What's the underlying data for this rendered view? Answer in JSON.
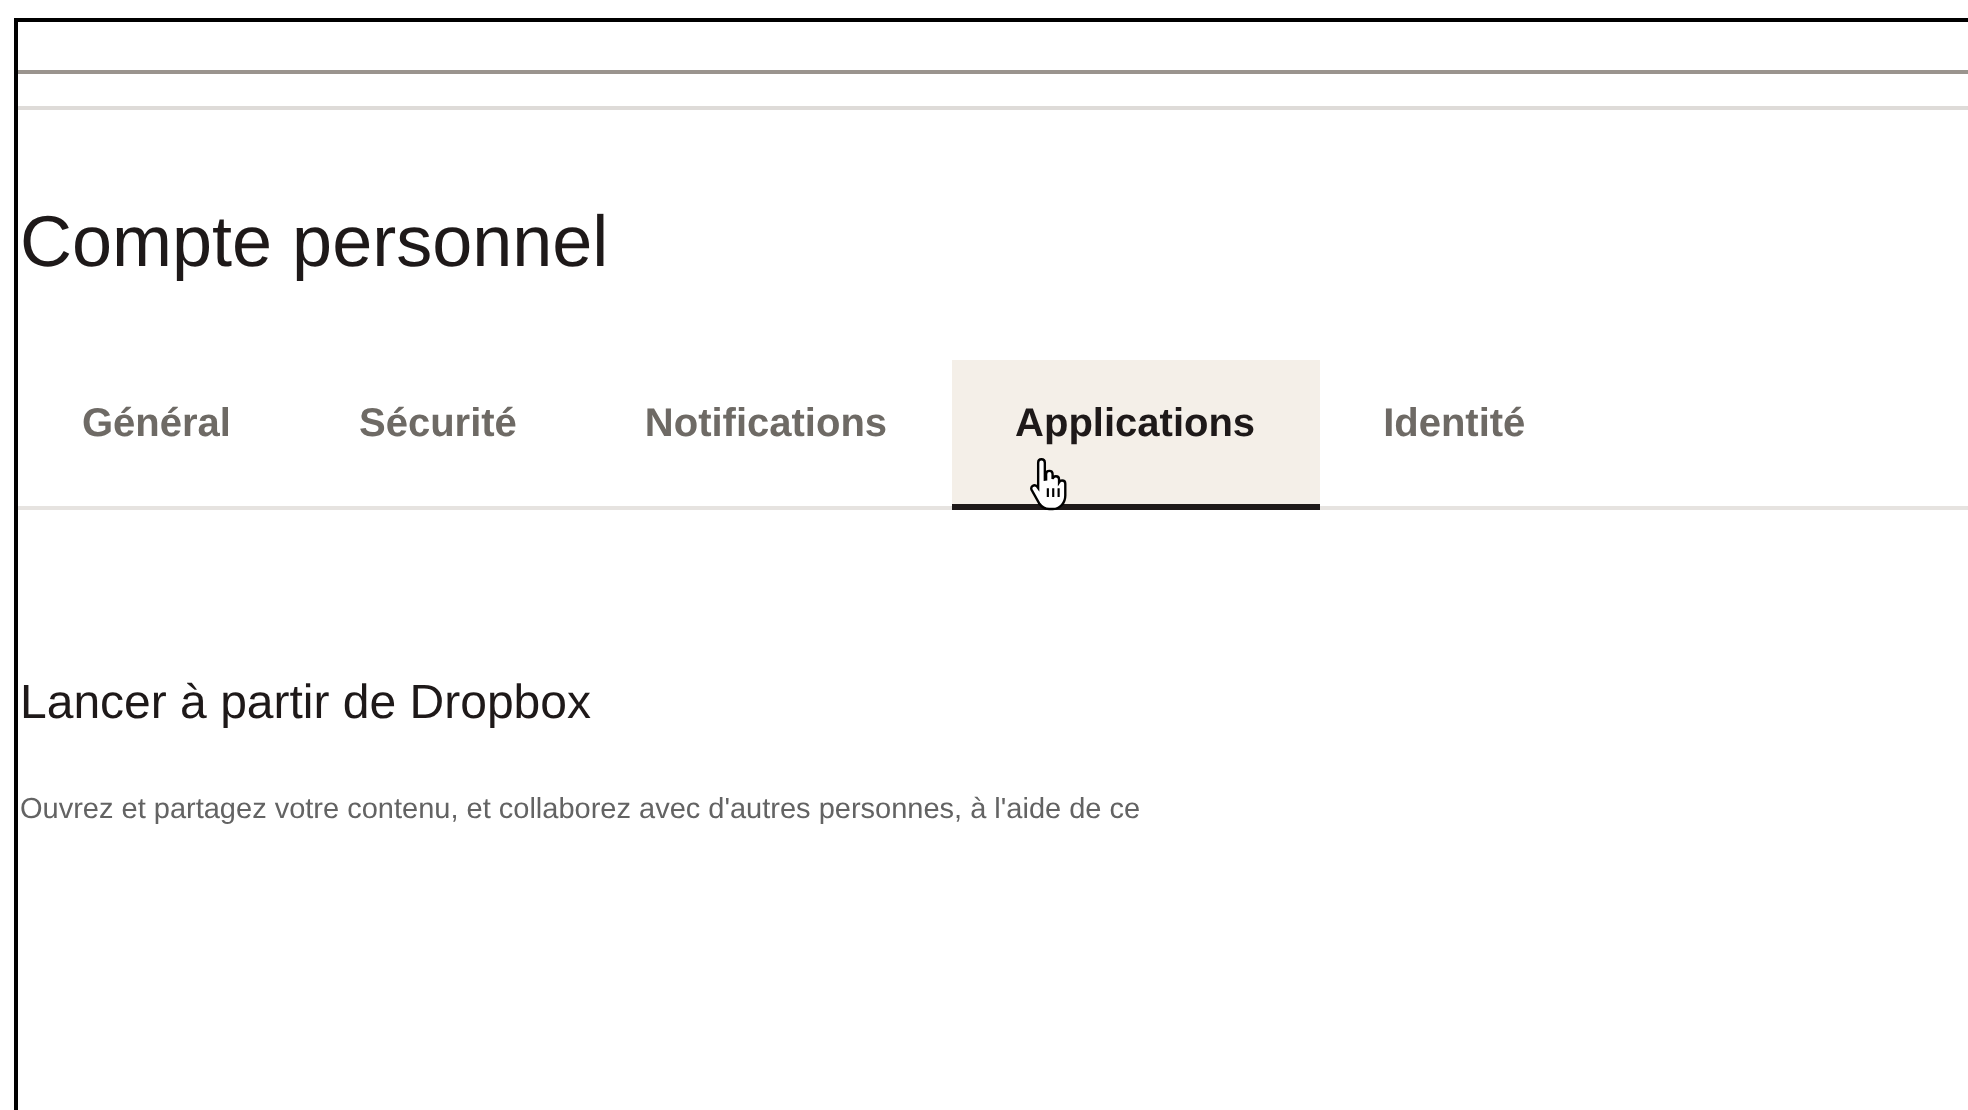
{
  "title": "Compte personnel",
  "tabs": [
    {
      "label": "Général",
      "selected": false
    },
    {
      "label": "Sécurité",
      "selected": false
    },
    {
      "label": "Notifications",
      "selected": false
    },
    {
      "label": "Applications",
      "selected": true
    },
    {
      "label": "Identité",
      "selected": false
    }
  ],
  "section": {
    "title": "Lancer à partir de Dropbox",
    "description": "Ouvrez et partagez votre contenu, et collaborez avec d'autres personnes, à l'aide de ce"
  }
}
